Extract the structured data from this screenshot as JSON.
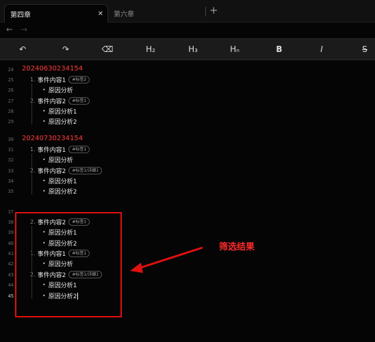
{
  "tabs": [
    {
      "label": "第四章",
      "active": true,
      "close": "✕"
    },
    {
      "label": "第六章",
      "active": false
    }
  ],
  "new_tab": "+",
  "nav": {
    "back": "←",
    "forward": "→"
  },
  "toolbar": [
    {
      "name": "undo-button",
      "icon": "↶"
    },
    {
      "name": "redo-button",
      "icon": "↷"
    },
    {
      "name": "clear-format-button",
      "icon": "⌫"
    },
    {
      "name": "heading2-button",
      "icon": "H₂"
    },
    {
      "name": "heading3-button",
      "icon": "H₃"
    },
    {
      "name": "heading-n-button",
      "icon": "Hₙ"
    },
    {
      "name": "bold-button",
      "icon": "B"
    },
    {
      "name": "italic-button",
      "icon": "I"
    },
    {
      "name": "strikethrough-button",
      "icon": "S"
    }
  ],
  "lines": [
    {
      "n": "24",
      "type": "date",
      "text": "20240630234154"
    },
    {
      "n": "25",
      "type": "event",
      "num": "1.",
      "text": "事件内容1",
      "tag": "#标签2"
    },
    {
      "n": "26",
      "type": "bullet",
      "text": "原因分析"
    },
    {
      "n": "27",
      "type": "event",
      "num": "2.",
      "text": "事件内容2",
      "tag": "#标签1"
    },
    {
      "n": "28",
      "type": "bullet",
      "text": "原因分析1"
    },
    {
      "n": "29",
      "type": "bullet",
      "text": "原因分析2"
    },
    {
      "n": "30",
      "type": "date",
      "text": "20240730234154"
    },
    {
      "n": "31",
      "type": "event",
      "num": "1.",
      "text": "事件内容1",
      "tag": "#标签1"
    },
    {
      "n": "32",
      "type": "bullet",
      "text": "原因分析"
    },
    {
      "n": "33",
      "type": "event",
      "num": "2.",
      "text": "事件内容2",
      "tag": "#标签1/详细1"
    },
    {
      "n": "34",
      "type": "bullet",
      "text": "原因分析1"
    },
    {
      "n": "35",
      "type": "bullet",
      "text": "原因分析2"
    },
    {
      "n": "37",
      "type": "blank",
      "text": ""
    },
    {
      "n": "38",
      "type": "event",
      "num": "2.",
      "text": "事件内容2",
      "tag": "#标签1"
    },
    {
      "n": "39",
      "type": "bullet",
      "text": "原因分析1"
    },
    {
      "n": "40",
      "type": "bullet",
      "text": "原因分析2"
    },
    {
      "n": "41",
      "type": "event",
      "num": "1.",
      "text": "事件内容1",
      "tag": "#标签1"
    },
    {
      "n": "42",
      "type": "bullet",
      "text": "原因分析"
    },
    {
      "n": "43",
      "type": "event",
      "num": "2.",
      "text": "事件内容2",
      "tag": "#标签1/详细1"
    },
    {
      "n": "44",
      "type": "bullet",
      "text": "原因分析1"
    },
    {
      "n": "45",
      "type": "bullet",
      "text": "原因分析2",
      "cursor": true
    }
  ],
  "annotation": "筛选结果",
  "colors": {
    "date": "#ff3b3b",
    "highlight": "#e01010"
  }
}
